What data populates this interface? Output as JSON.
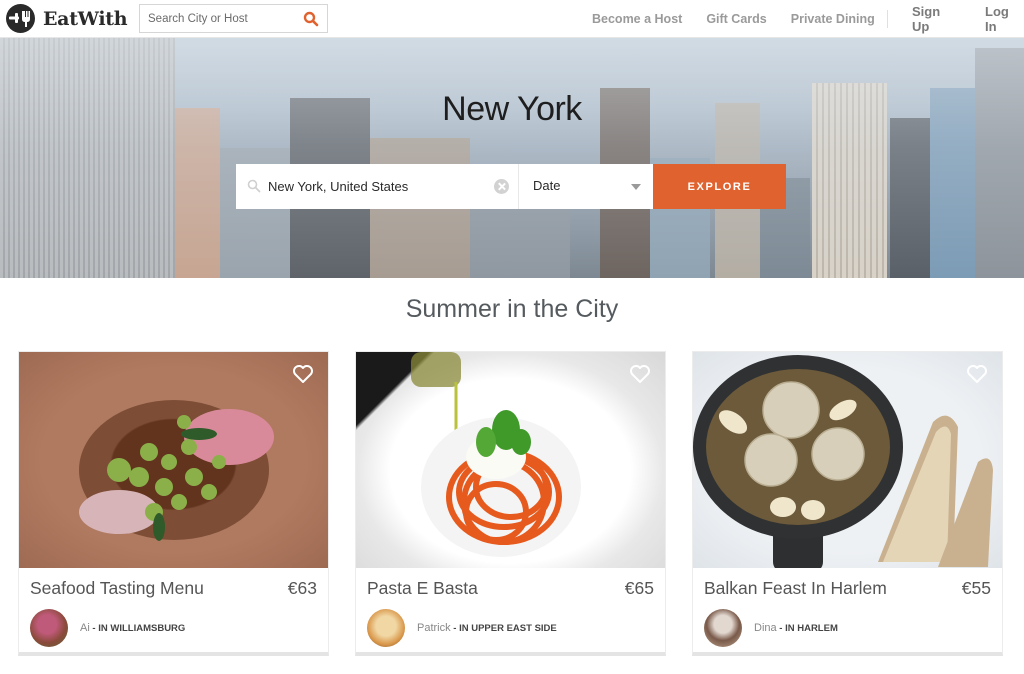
{
  "header": {
    "brand": "EatWith",
    "search_placeholder": "Search City or Host",
    "nav_left": [
      "Become a Host",
      "Gift Cards",
      "Private Dining"
    ],
    "nav_right": [
      "Sign Up",
      "Log In"
    ]
  },
  "hero": {
    "city": "New York",
    "location_value": "New York, United States",
    "date_label": "Date",
    "explore_label": "EXPLORE"
  },
  "colors": {
    "accent": "#e0632f",
    "brand_dark": "#2a2a2a"
  },
  "section": {
    "title": "Summer in the City"
  },
  "cards": [
    {
      "title": "Seafood Tasting Menu",
      "price": "€63",
      "host": "Ai",
      "location": "IN WILLIAMSBURG"
    },
    {
      "title": "Pasta E Basta",
      "price": "€65",
      "host": "Patrick",
      "location": "IN UPPER EAST SIDE"
    },
    {
      "title": "Balkan Feast In Harlem",
      "price": "€55",
      "host": "Dina",
      "location": "IN HARLEM"
    }
  ]
}
